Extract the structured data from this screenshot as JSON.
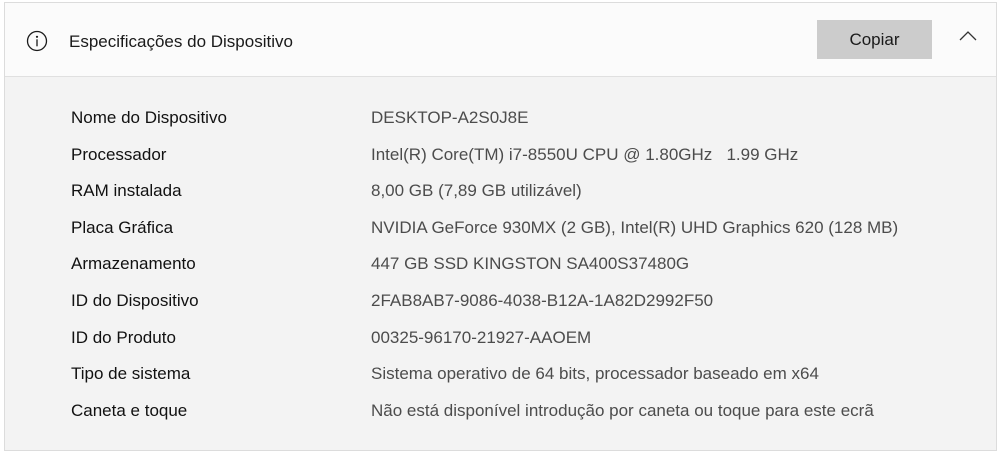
{
  "header": {
    "title": "Especificações do Dispositivo",
    "copy_label": "Copiar",
    "icon": "info-icon",
    "collapse_icon": "chevron-up-icon"
  },
  "specs": [
    {
      "label": "Nome do Dispositivo",
      "value": "DESKTOP-A2S0J8E"
    },
    {
      "label": "Processador",
      "value": "Intel(R) Core(TM) i7-8550U CPU @ 1.80GHz   1.99 GHz"
    },
    {
      "label": "RAM instalada",
      "value": "8,00 GB (7,89 GB utilizável)"
    },
    {
      "label": "Placa Gráfica",
      "value": "NVIDIA GeForce 930MX (2 GB), Intel(R) UHD Graphics 620 (128 MB)"
    },
    {
      "label": "Armazenamento",
      "value": "447 GB SSD KINGSTON SA400S37480G"
    },
    {
      "label": "ID do Dispositivo",
      "value": "2FAB8AB7-9086-4038-B12A-1A82D2992F50"
    },
    {
      "label": "ID do Produto",
      "value": "00325-96170-21927-AAOEM"
    },
    {
      "label": "Tipo de sistema",
      "value": "Sistema operativo de 64 bits, processador baseado em x64"
    },
    {
      "label": "Caneta e toque",
      "value": "Não está disponível introdução por caneta ou toque para este ecrã"
    }
  ]
}
